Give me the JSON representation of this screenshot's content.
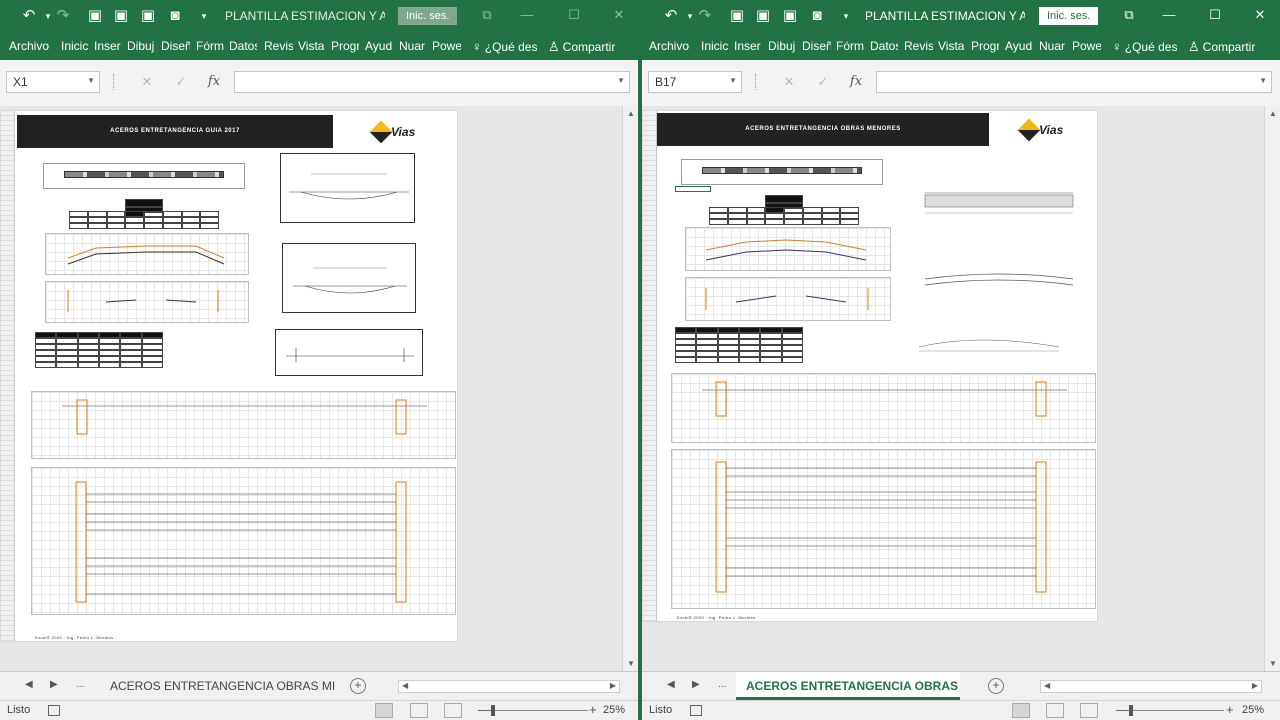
{
  "windows": [
    {
      "id": "left",
      "title": "PLANTILLA ESTIMACION Y A...",
      "sign_in": "Inic. ses.",
      "ribbon_tabs": [
        "Archivo",
        "Inicic",
        "Inser",
        "Dibuj",
        "Diseñ",
        "Fórm",
        "Datos",
        "Revis",
        "Vista",
        "Progr",
        "Ayud",
        "Nuar",
        "Powe"
      ],
      "tell_me": "¿Qué des",
      "share": "Compartir",
      "name_box": "X1",
      "formula_value": "",
      "page_header": "ACEROS ENTRETANGENCIA GUIA 2017",
      "logo_text": "Vias",
      "footer": "Excel® 2020 · Ing. Pedro L. Morales ·",
      "sheet_tab": "ACEROS ENTRETANGENCIA OBRAS MI",
      "sheet_tab_active": false,
      "status": "Listo",
      "zoom": "25%"
    },
    {
      "id": "right",
      "title": "PLANTILLA ESTIMACION Y A...",
      "sign_in": "Inic. ses.",
      "ribbon_tabs": [
        "Archivo",
        "Inicic",
        "Inser",
        "Dibuj",
        "Diseñ",
        "Fórm",
        "Datos",
        "Revis",
        "Vista",
        "Progr",
        "Ayud",
        "Nuar",
        "Powe"
      ],
      "tell_me": "¿Qué des",
      "share": "Compartir",
      "name_box": "B17",
      "formula_value": "",
      "page_header": "ACEROS ENTRETANGENCIA OBRAS MENORES",
      "logo_text": "Vias",
      "footer": "Excel® 2020 · Ing. Pedro L. Morales ·",
      "sheet_tab": "ACEROS ENTRETANGENCIA OBRAS M",
      "sheet_tab_active": true,
      "status": "Listo",
      "zoom": "25%"
    }
  ],
  "icons": {
    "undo": "↶",
    "redo": "↷",
    "save": "▣",
    "more": "▾",
    "restore": "⧉",
    "minimize": "—",
    "maximize": "☐",
    "close": "✕",
    "bulb": "♀",
    "person": "♙",
    "cancel": "✕",
    "enter": "✓",
    "fx": "fx",
    "prev": "◀",
    "next": "▶",
    "ellipsis": "...",
    "add": "+",
    "up": "▲",
    "down": "▼"
  },
  "colors": {
    "excel_green": "#217346",
    "header_black": "#222222",
    "accent_orange": "#e07b1a"
  }
}
